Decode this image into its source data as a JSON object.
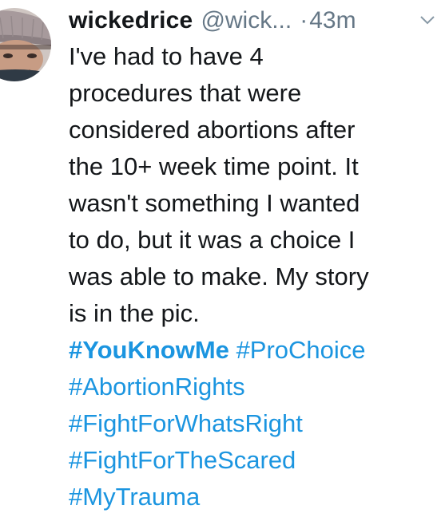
{
  "tweet": {
    "author": {
      "display_name": "wickedrice",
      "handle": "@wick...",
      "avatar_icon": "user-avatar-photo"
    },
    "separator": "·",
    "time": "43m",
    "menu_icon": "chevron-down-icon",
    "text_lines": [
      "I've had to have 4",
      "procedures that were",
      "considered abortions after",
      "the 10+ week time point.  It",
      "wasn't something I wanted",
      "to do, but it was a choice I",
      "was able to make. My story",
      "is in the pic."
    ],
    "hashtags": [
      "#YouKnowMe",
      "#ProChoice",
      "#AbortionRights",
      "#FightForWhatsRight",
      "#FightForTheScared",
      "#MyTrauma"
    ],
    "colors": {
      "text": "#14171a",
      "secondary": "#657786",
      "link": "#1b95e0"
    }
  }
}
